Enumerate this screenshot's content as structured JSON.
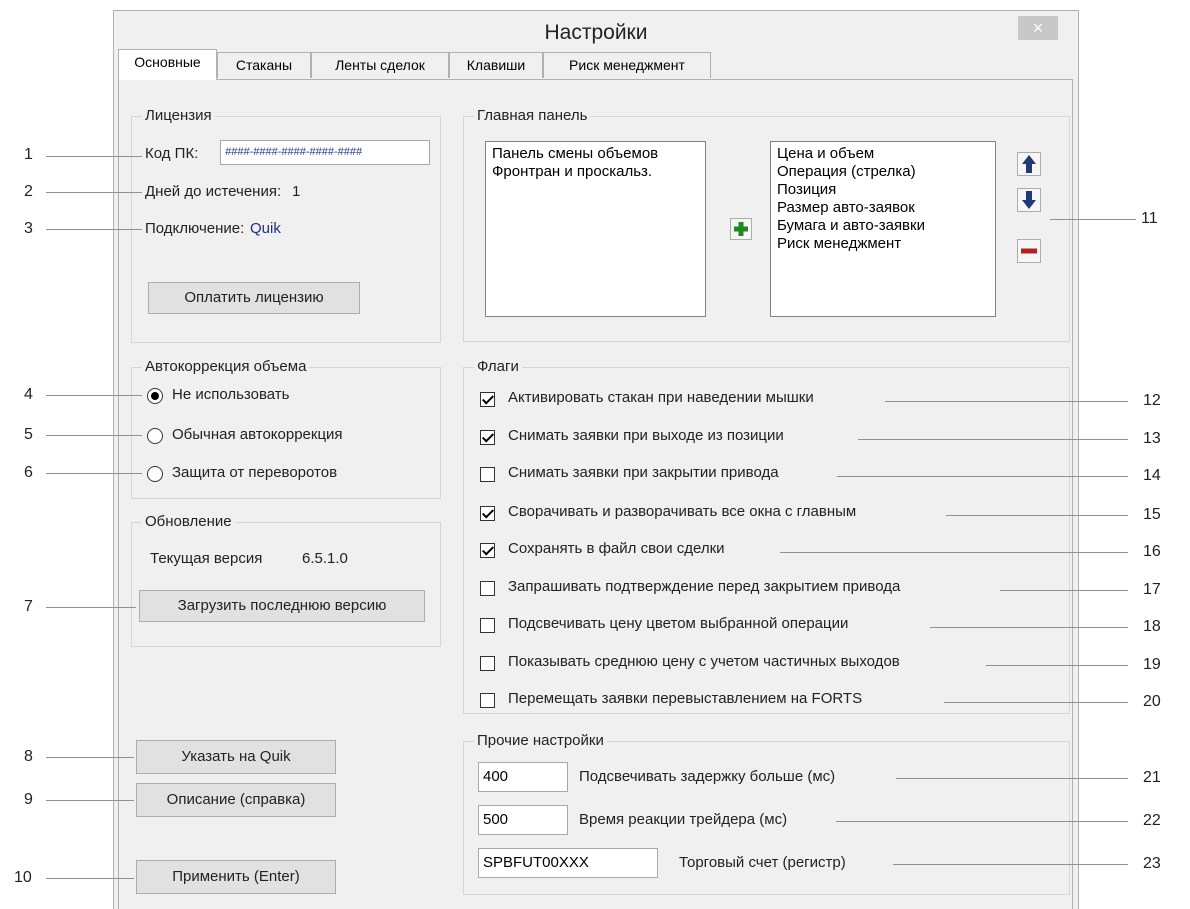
{
  "window": {
    "title": "Настройки",
    "close_glyph": "×"
  },
  "tabs": [
    "Основные",
    "Стаканы",
    "Ленты сделок",
    "Клавиши",
    "Риск менеджмент"
  ],
  "license": {
    "group_label": "Лицензия",
    "code_label": "Код ПК:",
    "code_value": "####-####-####-####-####",
    "days_label": "Дней до истечения:",
    "days_value": "1",
    "connection_label": "Подключение:",
    "connection_value": "Quik",
    "pay_button": "Оплатить лицензию"
  },
  "autocorrection": {
    "group_label": "Автокоррекция объема",
    "options": [
      "Не использовать",
      "Обычная автокоррекция",
      "Защита от переворотов"
    ],
    "selected_index": 0
  },
  "update": {
    "group_label": "Обновление",
    "version_label": "Текущая версия",
    "version_value": "6.5.1.0",
    "download_button": "Загрузить последнюю версию"
  },
  "buttons": {
    "point_quik": "Указать на Quik",
    "description": "Описание (справка)",
    "apply": "Применить (Enter)"
  },
  "main_panel": {
    "group_label": "Главная панель",
    "available": [
      "Панель смены объемов",
      "Фронтран и проскальз."
    ],
    "selected": [
      "Цена и объем",
      "Операция (стрелка)",
      "Позиция",
      "Размер авто-заявок",
      "Бумага и авто-заявки",
      "Риск менеджмент"
    ],
    "icons": {
      "add": "plus-icon",
      "up": "arrow-up-icon",
      "down": "arrow-down-icon",
      "remove": "minus-icon"
    },
    "colors": {
      "add": "#1f8a1f",
      "arrows": "#1e3a78",
      "remove": "#b22222"
    }
  },
  "flags": {
    "group_label": "Флаги",
    "items": [
      {
        "label": "Активировать стакан при наведении мышки",
        "checked": true
      },
      {
        "label": "Снимать заявки при выходе из позиции",
        "checked": true
      },
      {
        "label": "Снимать заявки при закрытии привода",
        "checked": false
      },
      {
        "label": "Сворачивать и разворачивать все окна с главным",
        "checked": true
      },
      {
        "label": "Сохранять в файл свои сделки",
        "checked": true
      },
      {
        "label": "Запрашивать подтверждение перед закрытием привода",
        "checked": false
      },
      {
        "label": "Подсвечивать цену цветом выбранной операции",
        "checked": false
      },
      {
        "label": "Показывать среднюю цену с учетом частичных выходов",
        "checked": false
      },
      {
        "label": "Перемещать заявки перевыставлением на FORTS",
        "checked": false
      }
    ]
  },
  "other": {
    "group_label": "Прочие настройки",
    "items": [
      {
        "value": "400",
        "label": "Подсвечивать задержку больше (мс)"
      },
      {
        "value": "500",
        "label": "Время реакции трейдера (мс)"
      },
      {
        "value": "SPBFUT00XXX",
        "label": "Торговый счет (регистр)"
      }
    ]
  },
  "annotations": {
    "left": [
      "1",
      "2",
      "3",
      "4",
      "5",
      "6",
      "7",
      "8",
      "9",
      "10"
    ],
    "right": [
      "11",
      "12",
      "13",
      "14",
      "15",
      "16",
      "17",
      "18",
      "19",
      "20",
      "21",
      "22",
      "23"
    ]
  }
}
